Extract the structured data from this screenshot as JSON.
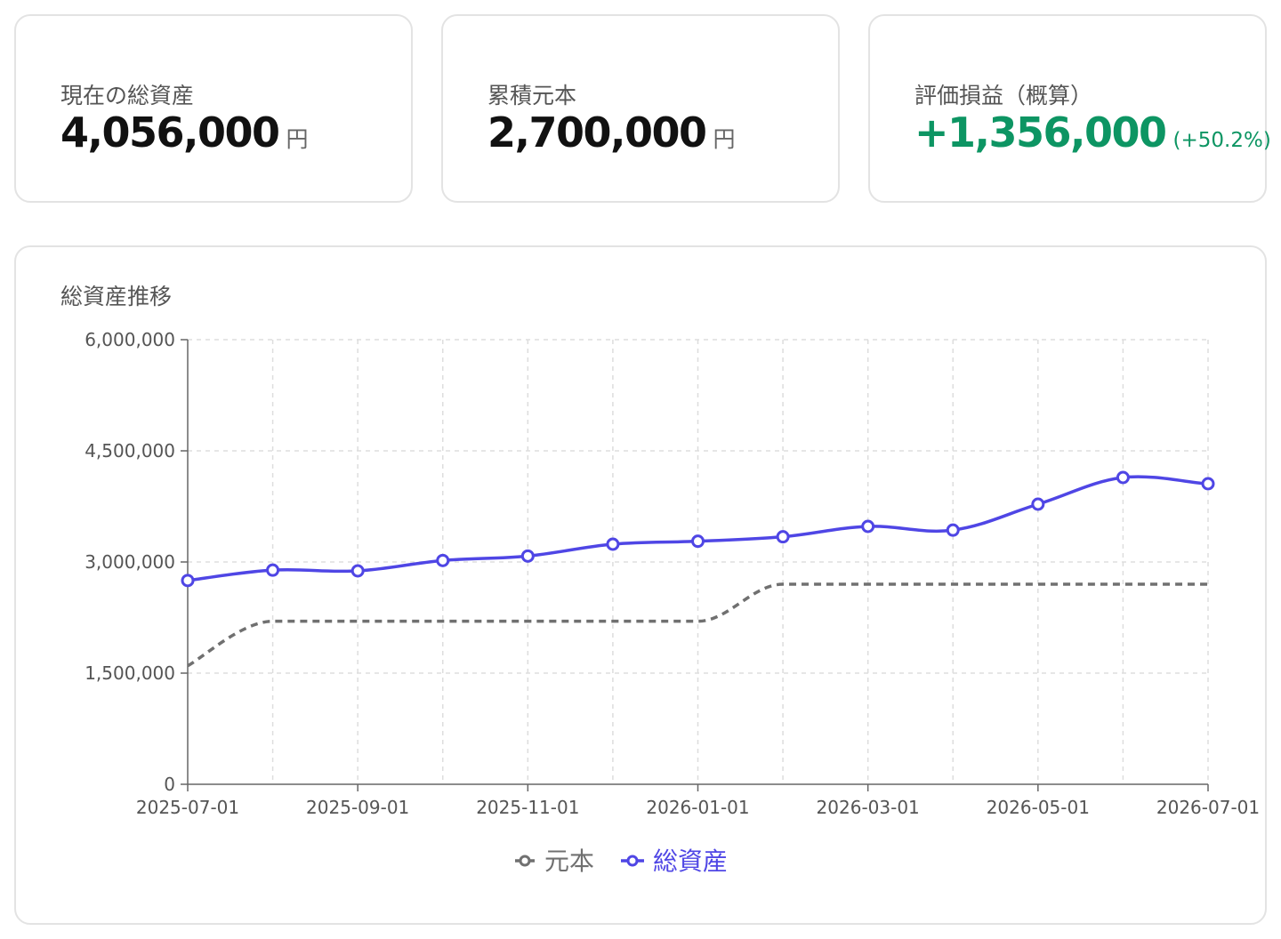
{
  "kpis": {
    "total_assets": {
      "label": "現在の総資産",
      "value": "4,056,000",
      "unit": "円"
    },
    "principal": {
      "label": "累積元本",
      "value": "2,700,000",
      "unit": "円"
    },
    "gain": {
      "label": "評価損益（概算）",
      "value": "+1,356,000",
      "pct": "(+50.2%)"
    }
  },
  "colors": {
    "principal": "#707070",
    "assets": "#4f46e5",
    "positive": "#0d9563"
  },
  "chart_data": {
    "type": "line",
    "title": "総資産推移",
    "x": [
      "2025-07-01",
      "2025-08-01",
      "2025-09-01",
      "2025-10-01",
      "2025-11-01",
      "2025-12-01",
      "2026-01-01",
      "2026-02-01",
      "2026-03-01",
      "2026-04-01",
      "2026-05-01",
      "2026-06-01",
      "2026-07-01"
    ],
    "x_tick_labels": [
      "2025-07-01",
      "2025-09-01",
      "2025-11-01",
      "2026-01-01",
      "2026-03-01",
      "2026-05-01",
      "2026-07-01"
    ],
    "y_tick_labels": [
      "0",
      "1,500,000",
      "3,000,000",
      "4,500,000",
      "6,000,000"
    ],
    "y_ticks": [
      0,
      1500000,
      3000000,
      4500000,
      6000000
    ],
    "ylim": [
      0,
      6000000
    ],
    "series": [
      {
        "name": "元本",
        "style": "dashed",
        "values": [
          1600000,
          2200000,
          2200000,
          2200000,
          2200000,
          2200000,
          2200000,
          2700000,
          2700000,
          2700000,
          2700000,
          2700000,
          2700000
        ]
      },
      {
        "name": "総資産",
        "style": "solid",
        "values": [
          2750000,
          2890000,
          2880000,
          3020000,
          3080000,
          3240000,
          3280000,
          3340000,
          3480000,
          3430000,
          3780000,
          4140000,
          4056000
        ]
      }
    ],
    "legend_position": "bottom",
    "grid": true
  }
}
